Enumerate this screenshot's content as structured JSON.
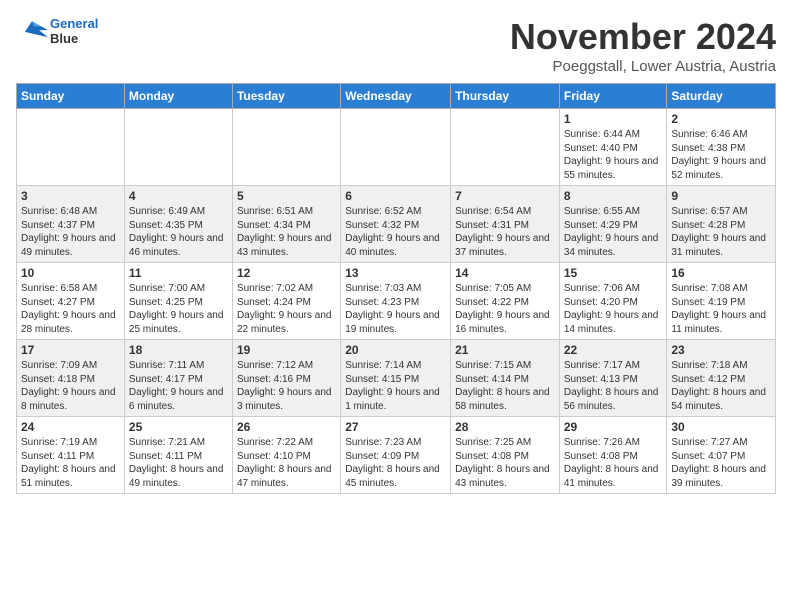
{
  "header": {
    "logo_line1": "General",
    "logo_line2": "Blue",
    "month_title": "November 2024",
    "location": "Poeggstall, Lower Austria, Austria"
  },
  "days_of_week": [
    "Sunday",
    "Monday",
    "Tuesday",
    "Wednesday",
    "Thursday",
    "Friday",
    "Saturday"
  ],
  "weeks": [
    {
      "days": [
        {
          "num": "",
          "info": ""
        },
        {
          "num": "",
          "info": ""
        },
        {
          "num": "",
          "info": ""
        },
        {
          "num": "",
          "info": ""
        },
        {
          "num": "",
          "info": ""
        },
        {
          "num": "1",
          "info": "Sunrise: 6:44 AM\nSunset: 4:40 PM\nDaylight: 9 hours and 55 minutes."
        },
        {
          "num": "2",
          "info": "Sunrise: 6:46 AM\nSunset: 4:38 PM\nDaylight: 9 hours and 52 minutes."
        }
      ]
    },
    {
      "days": [
        {
          "num": "3",
          "info": "Sunrise: 6:48 AM\nSunset: 4:37 PM\nDaylight: 9 hours and 49 minutes."
        },
        {
          "num": "4",
          "info": "Sunrise: 6:49 AM\nSunset: 4:35 PM\nDaylight: 9 hours and 46 minutes."
        },
        {
          "num": "5",
          "info": "Sunrise: 6:51 AM\nSunset: 4:34 PM\nDaylight: 9 hours and 43 minutes."
        },
        {
          "num": "6",
          "info": "Sunrise: 6:52 AM\nSunset: 4:32 PM\nDaylight: 9 hours and 40 minutes."
        },
        {
          "num": "7",
          "info": "Sunrise: 6:54 AM\nSunset: 4:31 PM\nDaylight: 9 hours and 37 minutes."
        },
        {
          "num": "8",
          "info": "Sunrise: 6:55 AM\nSunset: 4:29 PM\nDaylight: 9 hours and 34 minutes."
        },
        {
          "num": "9",
          "info": "Sunrise: 6:57 AM\nSunset: 4:28 PM\nDaylight: 9 hours and 31 minutes."
        }
      ]
    },
    {
      "days": [
        {
          "num": "10",
          "info": "Sunrise: 6:58 AM\nSunset: 4:27 PM\nDaylight: 9 hours and 28 minutes."
        },
        {
          "num": "11",
          "info": "Sunrise: 7:00 AM\nSunset: 4:25 PM\nDaylight: 9 hours and 25 minutes."
        },
        {
          "num": "12",
          "info": "Sunrise: 7:02 AM\nSunset: 4:24 PM\nDaylight: 9 hours and 22 minutes."
        },
        {
          "num": "13",
          "info": "Sunrise: 7:03 AM\nSunset: 4:23 PM\nDaylight: 9 hours and 19 minutes."
        },
        {
          "num": "14",
          "info": "Sunrise: 7:05 AM\nSunset: 4:22 PM\nDaylight: 9 hours and 16 minutes."
        },
        {
          "num": "15",
          "info": "Sunrise: 7:06 AM\nSunset: 4:20 PM\nDaylight: 9 hours and 14 minutes."
        },
        {
          "num": "16",
          "info": "Sunrise: 7:08 AM\nSunset: 4:19 PM\nDaylight: 9 hours and 11 minutes."
        }
      ]
    },
    {
      "days": [
        {
          "num": "17",
          "info": "Sunrise: 7:09 AM\nSunset: 4:18 PM\nDaylight: 9 hours and 8 minutes."
        },
        {
          "num": "18",
          "info": "Sunrise: 7:11 AM\nSunset: 4:17 PM\nDaylight: 9 hours and 6 minutes."
        },
        {
          "num": "19",
          "info": "Sunrise: 7:12 AM\nSunset: 4:16 PM\nDaylight: 9 hours and 3 minutes."
        },
        {
          "num": "20",
          "info": "Sunrise: 7:14 AM\nSunset: 4:15 PM\nDaylight: 9 hours and 1 minute."
        },
        {
          "num": "21",
          "info": "Sunrise: 7:15 AM\nSunset: 4:14 PM\nDaylight: 8 hours and 58 minutes."
        },
        {
          "num": "22",
          "info": "Sunrise: 7:17 AM\nSunset: 4:13 PM\nDaylight: 8 hours and 56 minutes."
        },
        {
          "num": "23",
          "info": "Sunrise: 7:18 AM\nSunset: 4:12 PM\nDaylight: 8 hours and 54 minutes."
        }
      ]
    },
    {
      "days": [
        {
          "num": "24",
          "info": "Sunrise: 7:19 AM\nSunset: 4:11 PM\nDaylight: 8 hours and 51 minutes."
        },
        {
          "num": "25",
          "info": "Sunrise: 7:21 AM\nSunset: 4:11 PM\nDaylight: 8 hours and 49 minutes."
        },
        {
          "num": "26",
          "info": "Sunrise: 7:22 AM\nSunset: 4:10 PM\nDaylight: 8 hours and 47 minutes."
        },
        {
          "num": "27",
          "info": "Sunrise: 7:23 AM\nSunset: 4:09 PM\nDaylight: 8 hours and 45 minutes."
        },
        {
          "num": "28",
          "info": "Sunrise: 7:25 AM\nSunset: 4:08 PM\nDaylight: 8 hours and 43 minutes."
        },
        {
          "num": "29",
          "info": "Sunrise: 7:26 AM\nSunset: 4:08 PM\nDaylight: 8 hours and 41 minutes."
        },
        {
          "num": "30",
          "info": "Sunrise: 7:27 AM\nSunset: 4:07 PM\nDaylight: 8 hours and 39 minutes."
        }
      ]
    }
  ]
}
